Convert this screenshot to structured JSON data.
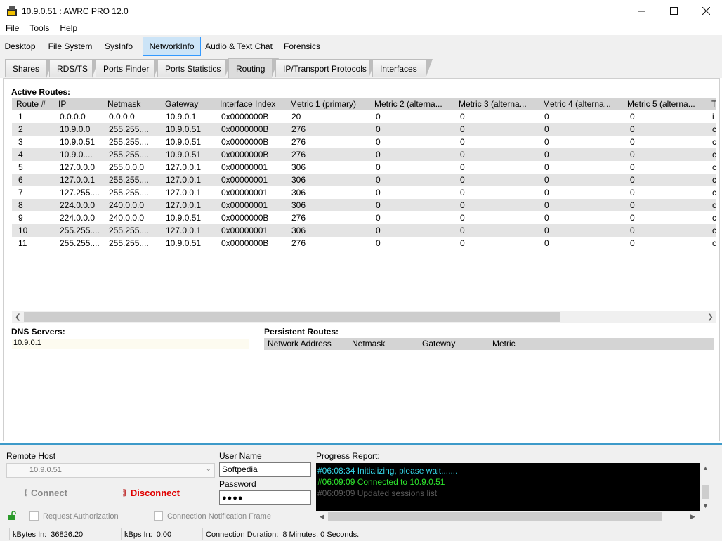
{
  "window": {
    "title": "10.9.0.51 : AWRC PRO 12.0"
  },
  "menu": [
    "File",
    "Tools",
    "Help"
  ],
  "main_tabs": [
    "Desktop",
    "File System",
    "SysInfo",
    "NetworkInfo",
    "Audio & Text Chat",
    "Forensics"
  ],
  "sub_tabs": [
    "Shares",
    "RDS/TS",
    "Ports Finder",
    "Ports Statistics",
    "Routing",
    "IP/Transport Protocols",
    "Interfaces"
  ],
  "routes": {
    "title": "Active Routes:",
    "columns": [
      "Route #",
      "IP",
      "Netmask",
      "Gateway",
      "Interface Index",
      "Metric 1 (primary)",
      "Metric 2 (alterna...",
      "Metric 3 (alterna...",
      "Metric 4 (alterna...",
      "Metric 5 (alterna...",
      "T"
    ],
    "rows": [
      [
        "1",
        "0.0.0.0",
        "0.0.0.0",
        "10.9.0.1",
        "0x0000000B",
        "20",
        "0",
        "0",
        "0",
        "0",
        "i"
      ],
      [
        "2",
        "10.9.0.0",
        "255.255....",
        "10.9.0.51",
        "0x0000000B",
        "276",
        "0",
        "0",
        "0",
        "0",
        "c"
      ],
      [
        "3",
        "10.9.0.51",
        "255.255....",
        "10.9.0.51",
        "0x0000000B",
        "276",
        "0",
        "0",
        "0",
        "0",
        "c"
      ],
      [
        "4",
        "10.9.0....",
        "255.255....",
        "10.9.0.51",
        "0x0000000B",
        "276",
        "0",
        "0",
        "0",
        "0",
        "c"
      ],
      [
        "5",
        "127.0.0.0",
        "255.0.0.0",
        "127.0.0.1",
        "0x00000001",
        "306",
        "0",
        "0",
        "0",
        "0",
        "c"
      ],
      [
        "6",
        "127.0.0.1",
        "255.255....",
        "127.0.0.1",
        "0x00000001",
        "306",
        "0",
        "0",
        "0",
        "0",
        "c"
      ],
      [
        "7",
        "127.255....",
        "255.255....",
        "127.0.0.1",
        "0x00000001",
        "306",
        "0",
        "0",
        "0",
        "0",
        "c"
      ],
      [
        "8",
        "224.0.0.0",
        "240.0.0.0",
        "127.0.0.1",
        "0x00000001",
        "306",
        "0",
        "0",
        "0",
        "0",
        "c"
      ],
      [
        "9",
        "224.0.0.0",
        "240.0.0.0",
        "10.9.0.51",
        "0x0000000B",
        "276",
        "0",
        "0",
        "0",
        "0",
        "c"
      ],
      [
        "10",
        "255.255....",
        "255.255....",
        "127.0.0.1",
        "0x00000001",
        "306",
        "0",
        "0",
        "0",
        "0",
        "c"
      ],
      [
        "11",
        "255.255....",
        "255.255....",
        "10.9.0.51",
        "0x0000000B",
        "276",
        "0",
        "0",
        "0",
        "0",
        "c"
      ]
    ]
  },
  "dns": {
    "title": "DNS Servers:",
    "value": "10.9.0.1"
  },
  "persistent": {
    "title": "Persistent Routes:",
    "columns": [
      "Network Address",
      "Netmask",
      "Gateway",
      "Metric"
    ]
  },
  "connection": {
    "remote_host_label": "Remote Host",
    "remote_host_value": "10.9.0.51",
    "user_label": "User Name",
    "user_value": "Softpedia",
    "password_label": "Password",
    "password_value": "●●●●",
    "connect_label": "Connect",
    "disconnect_label": "Disconnect",
    "request_auth_label": "Request Authorization",
    "notify_frame_label": "Connection Notification Frame"
  },
  "progress": {
    "title": "Progress Report:",
    "lines": [
      {
        "text": "#06:08:34 Initializing, please wait.......",
        "color": "#35d6e8"
      },
      {
        "text": "#06:09:09 Connected to 10.9.0.51",
        "color": "#2ee82e"
      },
      {
        "text": "#06:09:09 Updated sessions list",
        "color": "#5a5a5a"
      }
    ]
  },
  "status": {
    "kbytes_in_label": "kBytes In:",
    "kbytes_in_value": "36826.20",
    "kbps_in_label": "kBps In:",
    "kbps_in_value": "0.00",
    "duration_label": "Connection Duration:",
    "duration_value": "8 Minutes, 0 Seconds."
  },
  "colors": {
    "accent": "#3399ff",
    "active_tab_bg": "#cce4f7",
    "panel_border": "#3d9ac9",
    "disconnect": "#e00000"
  }
}
